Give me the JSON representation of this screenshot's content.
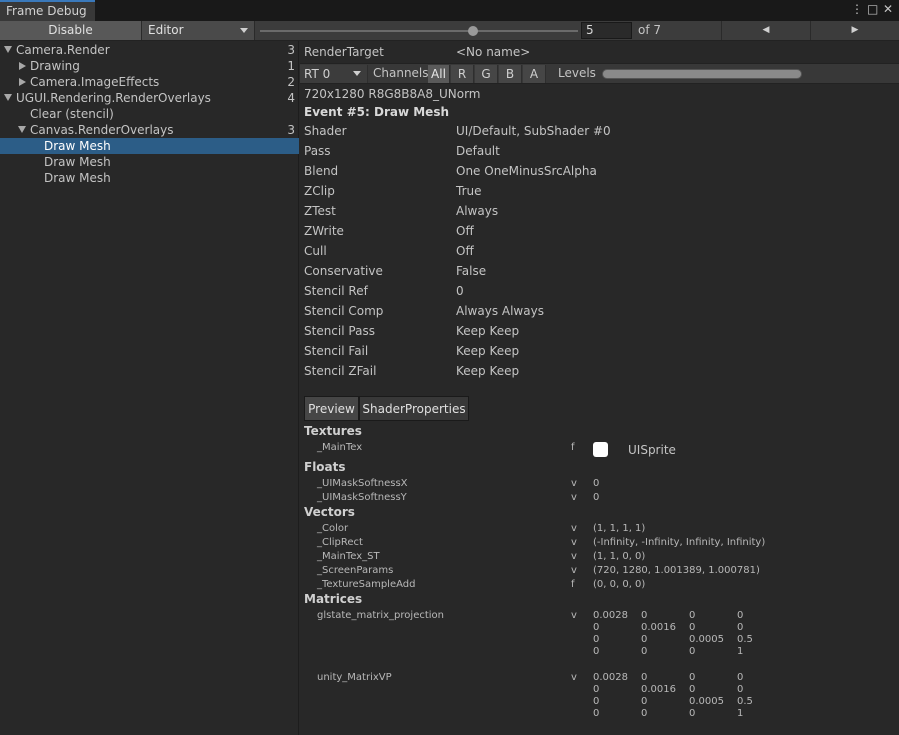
{
  "window": {
    "tab_title": "Frame Debug",
    "controls": [
      "⋮",
      "□",
      "✕"
    ]
  },
  "toolbar": {
    "disable_label": "Disable",
    "target_label": "Editor",
    "frame_value": "5",
    "frame_total_label": "of 7",
    "slider_fraction": 0.67,
    "prev_icon": "◀",
    "next_icon": "▶"
  },
  "tree": {
    "items": [
      {
        "label": "Camera.Render",
        "count": "3",
        "fold": "open"
      },
      {
        "label": "Drawing",
        "count": "1",
        "fold": "closed"
      },
      {
        "label": "Camera.ImageEffects",
        "count": "2",
        "fold": "closed"
      },
      {
        "label": "UGUI.Rendering.RenderOverlays",
        "count": "4",
        "fold": "open"
      },
      {
        "label": "Clear (stencil)",
        "count": "",
        "fold": "none"
      },
      {
        "label": "Canvas.RenderOverlays",
        "count": "3",
        "fold": "open"
      },
      {
        "label": "Draw Mesh",
        "count": "",
        "fold": "none"
      },
      {
        "label": "Draw Mesh",
        "count": "",
        "fold": "none"
      },
      {
        "label": "Draw Mesh",
        "count": "",
        "fold": "none"
      }
    ]
  },
  "detail": {
    "render_target_label": "RenderTarget",
    "render_target_value": "<No name>",
    "rt_select": "RT 0",
    "channels_label": "Channels",
    "channels": [
      "All",
      "R",
      "G",
      "B",
      "A"
    ],
    "levels_label": "Levels",
    "format": "720x1280 R8G8B8A8_UNorm",
    "event_title": "Event #5: Draw Mesh",
    "props": [
      {
        "k": "Shader",
        "v": "UI/Default, SubShader #0"
      },
      {
        "k": "Pass",
        "v": "Default"
      },
      {
        "k": "Blend",
        "v": "One OneMinusSrcAlpha"
      },
      {
        "k": "ZClip",
        "v": "True"
      },
      {
        "k": "ZTest",
        "v": "Always"
      },
      {
        "k": "ZWrite",
        "v": "Off"
      },
      {
        "k": "Cull",
        "v": "Off"
      },
      {
        "k": "Conservative",
        "v": "False"
      },
      {
        "k": "Stencil Ref",
        "v": "0"
      },
      {
        "k": "Stencil Comp",
        "v": "Always Always"
      },
      {
        "k": "Stencil Pass",
        "v": "Keep Keep"
      },
      {
        "k": "Stencil Fail",
        "v": "Keep Keep"
      },
      {
        "k": "Stencil ZFail",
        "v": "Keep Keep"
      }
    ],
    "tabs": [
      "Preview",
      "ShaderProperties"
    ],
    "sections": {
      "textures": "Textures",
      "floats": "Floats",
      "vectors": "Vectors",
      "matrices": "Matrices"
    },
    "textures": [
      {
        "name": "_MainTex",
        "type": "f",
        "value": "UISprite"
      }
    ],
    "floats": [
      {
        "name": "_UIMaskSoftnessX",
        "type": "v",
        "value": "0"
      },
      {
        "name": "_UIMaskSoftnessY",
        "type": "v",
        "value": "0"
      }
    ],
    "vectors": [
      {
        "name": "_Color",
        "type": "v",
        "value": "(1, 1, 1, 1)"
      },
      {
        "name": "_ClipRect",
        "type": "v",
        "value": "(-Infinity, -Infinity, Infinity, Infinity)"
      },
      {
        "name": "_MainTex_ST",
        "type": "v",
        "value": "(1, 1, 0, 0)"
      },
      {
        "name": "_ScreenParams",
        "type": "v",
        "value": "(720, 1280, 1.001389, 1.000781)"
      },
      {
        "name": "_TextureSampleAdd",
        "type": "f",
        "value": "(0, 0, 0, 0)"
      }
    ],
    "matrices": [
      {
        "name": "glstate_matrix_projection",
        "type": "v",
        "rows": [
          [
            "0.0028",
            "0",
            "0",
            "0"
          ],
          [
            "0",
            "0.0016",
            "0",
            "0"
          ],
          [
            "0",
            "0",
            "0.0005",
            "0.5"
          ],
          [
            "0",
            "0",
            "0",
            "1"
          ]
        ]
      },
      {
        "name": "unity_MatrixVP",
        "type": "v",
        "rows": [
          [
            "0.0028",
            "0",
            "0",
            "0"
          ],
          [
            "0",
            "0.0016",
            "0",
            "0"
          ],
          [
            "0",
            "0",
            "0.0005",
            "0.5"
          ],
          [
            "0",
            "0",
            "0",
            "1"
          ]
        ]
      }
    ]
  }
}
